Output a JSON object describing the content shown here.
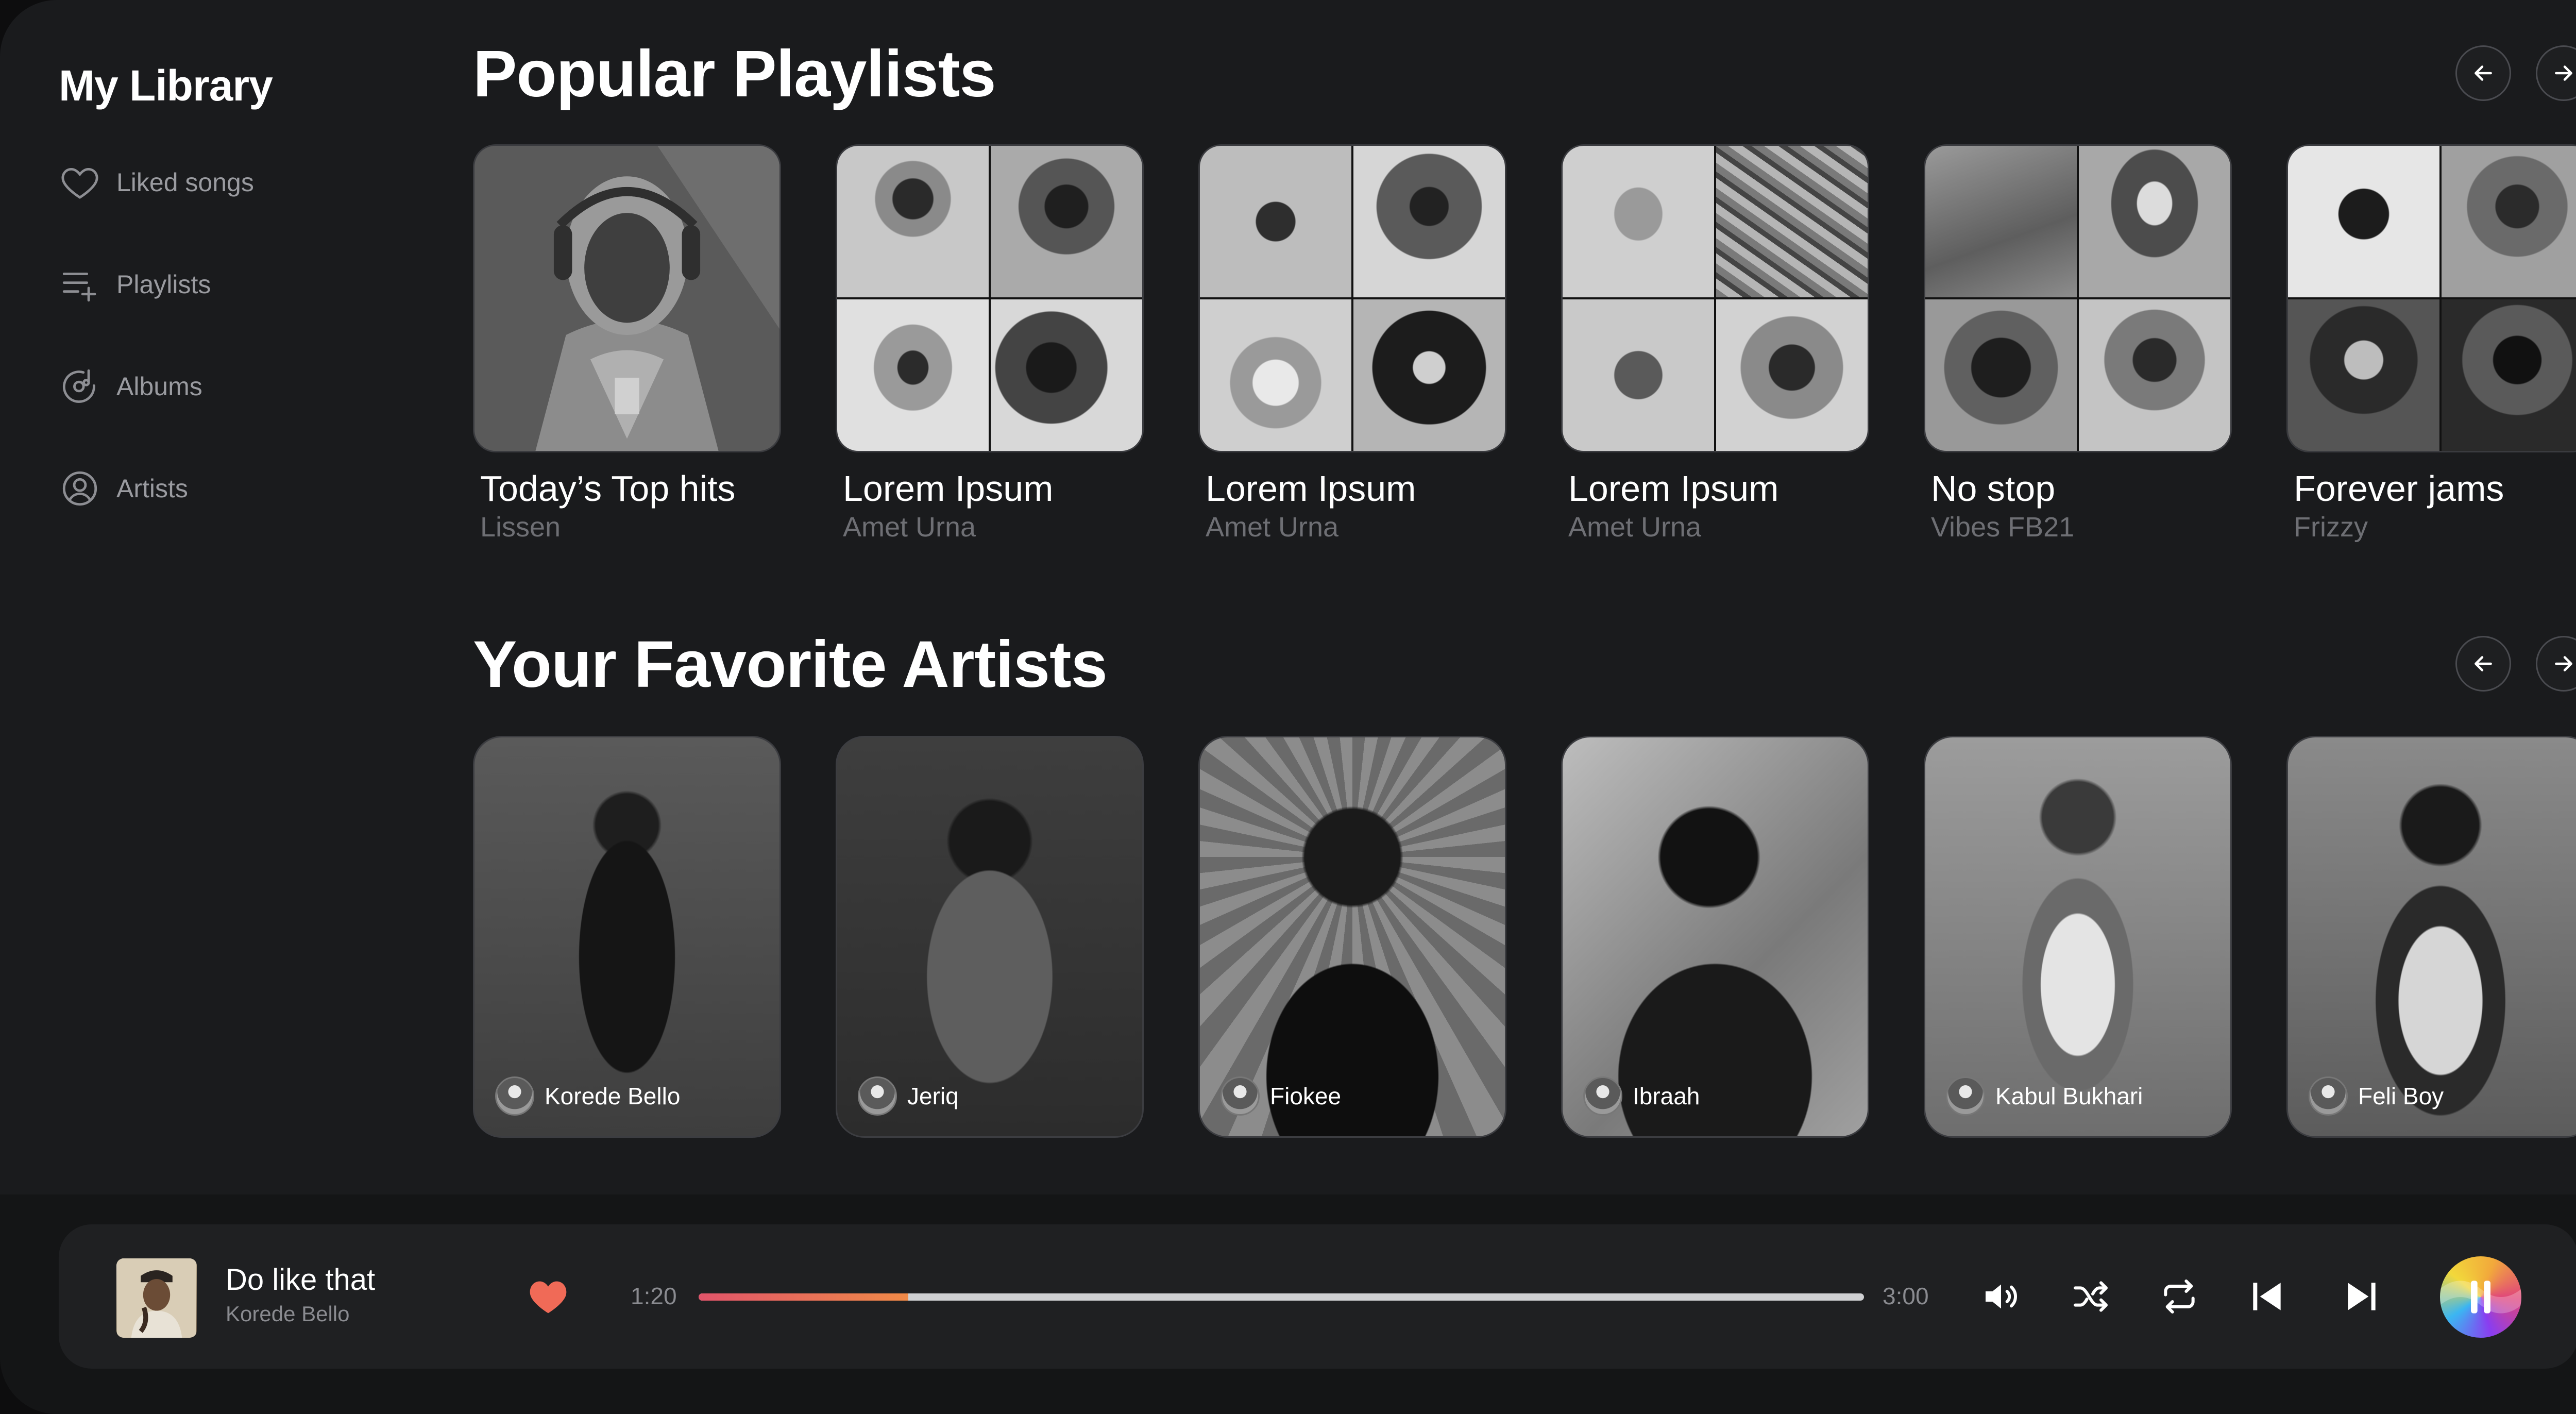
{
  "sidebar": {
    "title": "My Library",
    "items": [
      {
        "label": "Liked songs",
        "icon": "heart-icon"
      },
      {
        "label": "Playlists",
        "icon": "playlist-add-icon"
      },
      {
        "label": "Albums",
        "icon": "album-icon"
      },
      {
        "label": "Artists",
        "icon": "user-icon"
      }
    ]
  },
  "playlists": {
    "title": "Popular Playlists",
    "items": [
      {
        "title": "Today’s Top hits",
        "subtitle": "Lissen"
      },
      {
        "title": "Lorem Ipsum",
        "subtitle": "Amet Urna"
      },
      {
        "title": "Lorem Ipsum",
        "subtitle": "Amet Urna"
      },
      {
        "title": "Lorem Ipsum",
        "subtitle": "Amet Urna"
      },
      {
        "title": "No stop",
        "subtitle": "Vibes FB21"
      },
      {
        "title": "Forever jams",
        "subtitle": "Frizzy"
      }
    ]
  },
  "artists": {
    "title": "Your Favorite Artists",
    "items": [
      {
        "name": "Korede Bello"
      },
      {
        "name": "Jeriq"
      },
      {
        "name": "Fiokee"
      },
      {
        "name": "Ibraah"
      },
      {
        "name": "Kabul Bukhari"
      },
      {
        "name": "Feli Boy"
      }
    ]
  },
  "player": {
    "track_title": "Do like that",
    "track_artist": "Korede Bello",
    "current_time": "1:20",
    "total_time": "3:00",
    "progress": 0.18,
    "liked": true
  },
  "colors": {
    "background": "#1a1b1d",
    "accent_start": "#e0546a",
    "accent_end": "#f08a47",
    "heart": "#f06a57"
  }
}
